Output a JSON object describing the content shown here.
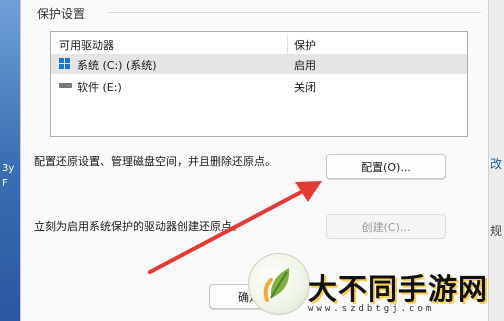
{
  "desktop": {
    "left_text": [
      "3y",
      "F"
    ]
  },
  "dialog": {
    "group_title": "保护设置",
    "table": {
      "col_drive": "可用驱动器",
      "col_protection": "保护",
      "rows": [
        {
          "drive": "系统 (C:) (系统)",
          "protection": "启用",
          "icon": "windows-drive-icon",
          "selected": true
        },
        {
          "drive": "软件 (E:)",
          "protection": "关闭",
          "icon": "hard-drive-icon",
          "selected": false
        }
      ]
    },
    "configure_desc": "配置还原设置、管理磁盘空间，并且删除还原点。",
    "configure_button": "配置(O)...",
    "create_desc": "立刻为启用系统保护的驱动器创建还原点。",
    "create_button": "创建(C)...",
    "ok_button": "确定"
  },
  "right_strip": {
    "text1": "改",
    "text2": "规"
  },
  "annotation": {
    "arrow_color": "#e53935"
  },
  "watermark": {
    "brand": "大不同手游网",
    "url": "www.szdbtgj.com"
  }
}
